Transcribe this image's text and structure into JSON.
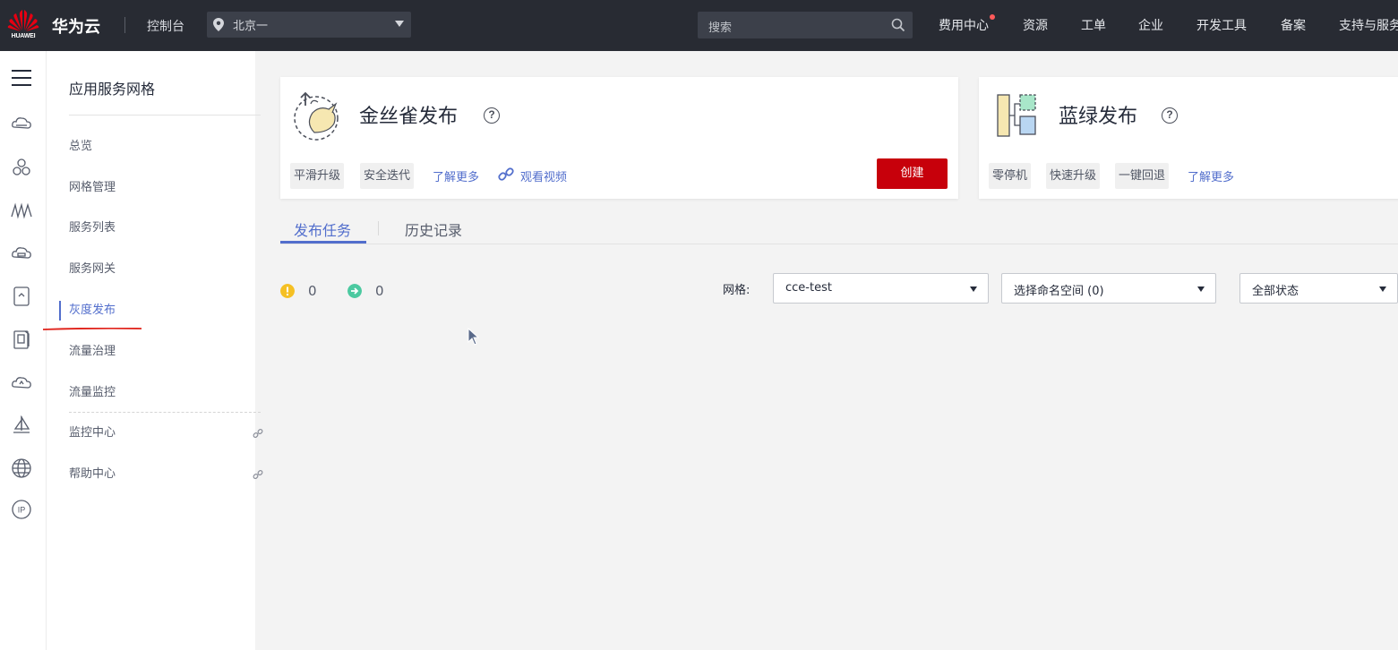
{
  "topbar": {
    "logo_text": "HUAWEI",
    "brand": "华为云",
    "console": "控制台",
    "region": "北京一",
    "search_placeholder": "搜索",
    "nav": [
      "费用中心",
      "资源",
      "工单",
      "企业",
      "开发工具",
      "备案",
      "支持与服务"
    ],
    "colors": {
      "background": "#282b33",
      "notification_dot": "#ff5a5a"
    }
  },
  "rail": {
    "icons": [
      "menu-icon",
      "cloud-disk-icon",
      "cluster-icon",
      "mesh-icon",
      "cloud-storage-icon",
      "container-icon",
      "file-icon",
      "cloud-refresh-icon",
      "sailboat-icon",
      "globe-icon",
      "ip-icon"
    ]
  },
  "sidebar": {
    "title": "应用服务网格",
    "items": [
      {
        "label": "总览"
      },
      {
        "label": "网格管理"
      },
      {
        "label": "服务列表"
      },
      {
        "label": "服务网关"
      },
      {
        "label": "灰度发布",
        "active": true
      },
      {
        "label": "流量治理"
      },
      {
        "label": "流量监控"
      }
    ],
    "external_items": [
      {
        "label": "监控中心"
      },
      {
        "label": "帮助中心"
      }
    ],
    "colors": {
      "active": "#526ecc",
      "annotation": "#e0241c"
    }
  },
  "canary_card": {
    "title": "金丝雀发布",
    "tags": [
      "平滑升级",
      "安全迭代"
    ],
    "learn_more": "了解更多",
    "watch_video": "观看视频",
    "create_button": "创建"
  },
  "bluegreen_card": {
    "title": "蓝绿发布",
    "tags": [
      "零停机",
      "快速升级",
      "一键回退"
    ],
    "learn_more": "了解更多"
  },
  "tabs": [
    {
      "label": "发布任务",
      "active": true
    },
    {
      "label": "历史记录",
      "active": false
    }
  ],
  "status": {
    "warning_count": "0",
    "running_count": "0",
    "colors": {
      "warning": "#f5c024",
      "running": "#4bc9a0"
    }
  },
  "filters": {
    "mesh_label": "网格:",
    "mesh_value": "cce-test",
    "namespace_value": "选择命名空间 (0)",
    "status_value": "全部状态"
  },
  "colors": {
    "accent": "#526ecc",
    "danger_button": "#c7000b"
  }
}
